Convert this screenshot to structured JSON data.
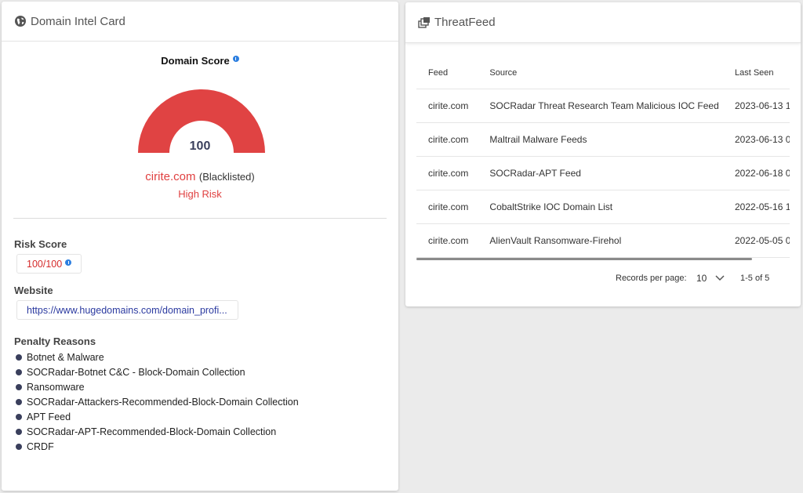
{
  "intel_card": {
    "title": "Domain Intel Card",
    "score_title": "Domain Score",
    "score_value": "100",
    "gauge_color": "#e04343",
    "domain": "cirite.com",
    "status": "(Blacklisted)",
    "risk_level": "High Risk",
    "risk_label": "Risk Score",
    "risk_value": "100/100",
    "website_label": "Website",
    "website_value": "https://www.hugedomains.com/domain_profi...",
    "penalty_label": "Penalty Reasons",
    "penalty_reasons": [
      "Botnet & Malware",
      "SOCRadar-Botnet C&C - Block-Domain Collection",
      "Ransomware",
      "SOCRadar-Attackers-Recommended-Block-Domain Collection",
      "APT Feed",
      "SOCRadar-APT-Recommended-Block-Domain Collection",
      "CRDF"
    ]
  },
  "threat_feed": {
    "title": "ThreatFeed",
    "columns": [
      "Feed",
      "Source",
      "Last Seen"
    ],
    "rows": [
      [
        "cirite.com",
        "SOCRadar Threat Research Team Malicious IOC Feed",
        "2023-06-13 1"
      ],
      [
        "cirite.com",
        "Maltrail Malware Feeds",
        "2023-06-13 0"
      ],
      [
        "cirite.com",
        "SOCRadar-APT Feed",
        "2022-06-18 0"
      ],
      [
        "cirite.com",
        "CobaltStrike IOC Domain List",
        "2022-05-16 1"
      ],
      [
        "cirite.com",
        "AlienVault Ransomware-Firehol",
        "2022-05-05 0"
      ]
    ],
    "records_per_page_label": "Records per page:",
    "records_per_page_value": "10",
    "range": "1-5 of 5"
  }
}
